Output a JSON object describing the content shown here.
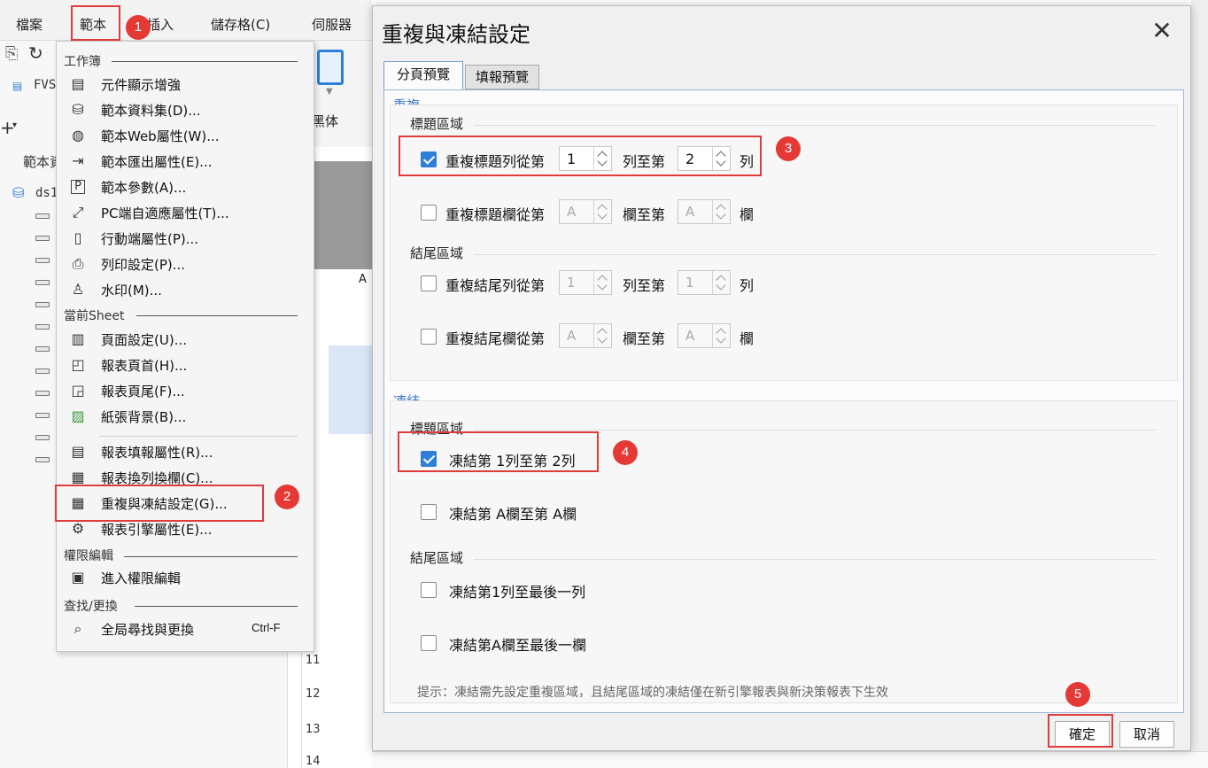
{
  "menubar": {
    "items": [
      "檔案",
      "範本",
      "插入",
      "儲存格(C)",
      "伺服器"
    ]
  },
  "left_panel": {
    "fvs_label": "FVS",
    "template_label": "範本資",
    "ds_label": "ds1",
    "font_box": "黑体"
  },
  "sheet": {
    "col_a": "A",
    "row_numbers": [
      "11",
      "12",
      "13",
      "14"
    ]
  },
  "template_menu": {
    "section_workbook": "工作簿",
    "workbook_items": [
      {
        "label": "元件顯示增強",
        "icon": "component-display-icon"
      },
      {
        "label": "範本資料集(D)...",
        "icon": "dataset-icon"
      },
      {
        "label": "範本Web屬性(W)...",
        "icon": "globe-icon"
      },
      {
        "label": "範本匯出屬性(E)...",
        "icon": "export-icon"
      },
      {
        "label": "範本參數(A)...",
        "icon": "parameter-icon"
      },
      {
        "label": "PC端自適應屬性(T)...",
        "icon": "adaptive-icon"
      },
      {
        "label": "行動端屬性(P)...",
        "icon": "mobile-icon"
      },
      {
        "label": "列印設定(P)...",
        "icon": "printer-icon"
      },
      {
        "label": "水印(M)...",
        "icon": "watermark-icon"
      }
    ],
    "section_sheet": "當前Sheet",
    "sheet_items": [
      {
        "label": "頁面設定(U)...",
        "icon": "page-setup-icon"
      },
      {
        "label": "報表頁首(H)...",
        "icon": "header-icon"
      },
      {
        "label": "報表頁尾(F)...",
        "icon": "footer-icon"
      },
      {
        "label": "紙張背景(B)...",
        "icon": "background-image-icon"
      },
      {
        "label": "報表填報屬性(R)...",
        "icon": "fill-report-icon"
      },
      {
        "label": "報表換列換欄(C)...",
        "icon": "row-column-icon"
      },
      {
        "label": "重複與凍結設定(G)...",
        "icon": "freeze-icon"
      },
      {
        "label": "報表引擎屬性(E)...",
        "icon": "engine-icon"
      }
    ],
    "section_permission": "權限編輯",
    "permission_items": [
      {
        "label": "進入權限編輯",
        "icon": "permission-icon"
      }
    ],
    "section_find": "查找/更換",
    "find_item": {
      "label": "全局尋找與更換",
      "shortcut": "Ctrl-F",
      "icon": "search-icon"
    }
  },
  "dialog": {
    "title": "重複與凍結設定",
    "tabs": [
      "分頁預覽",
      "填報預覽"
    ],
    "repeat_section": "重複",
    "repeat_title_area": "標題區域",
    "repeat_title_row": {
      "label": "重複標題列從第",
      "from": "1",
      "mid": "列至第",
      "to": "2",
      "unit": "列",
      "checked": true
    },
    "repeat_title_col": {
      "label": "重複標題欄從第",
      "from": "A",
      "mid": "欄至第",
      "to": "A",
      "unit": "欄",
      "checked": false
    },
    "repeat_footer_area": "結尾區域",
    "repeat_footer_row": {
      "label": "重複結尾列從第",
      "from": "1",
      "mid": "列至第",
      "to": "1",
      "unit": "列",
      "checked": false
    },
    "repeat_footer_col": {
      "label": "重複結尾欄從第",
      "from": "A",
      "mid": "欄至第",
      "to": "A",
      "unit": "欄",
      "checked": false
    },
    "freeze_section": "凍結",
    "freeze_title_area": "標題區域",
    "freeze_title_row": {
      "label": "凍結第 1列至第 2列",
      "checked": true
    },
    "freeze_title_col": {
      "label": "凍結第 A欄至第 A欄",
      "checked": false
    },
    "freeze_footer_area": "結尾區域",
    "freeze_footer_row": {
      "label": "凍結第1列至最後一列",
      "checked": false
    },
    "freeze_footer_col": {
      "label": "凍結第A欄至最後一欄",
      "checked": false
    },
    "hint": "提示：凍結需先設定重複區域，且結尾區域的凍結僅在新引擎報表與新決策報表下生效",
    "ok_label": "確定",
    "cancel_label": "取消"
  },
  "annotations": [
    "1",
    "2",
    "3",
    "4",
    "5"
  ],
  "colors": {
    "accent": "#2f7fd8",
    "highlight_red": "#e03c3c",
    "badge_red": "#e53935",
    "section_blue": "#3a78c8"
  }
}
